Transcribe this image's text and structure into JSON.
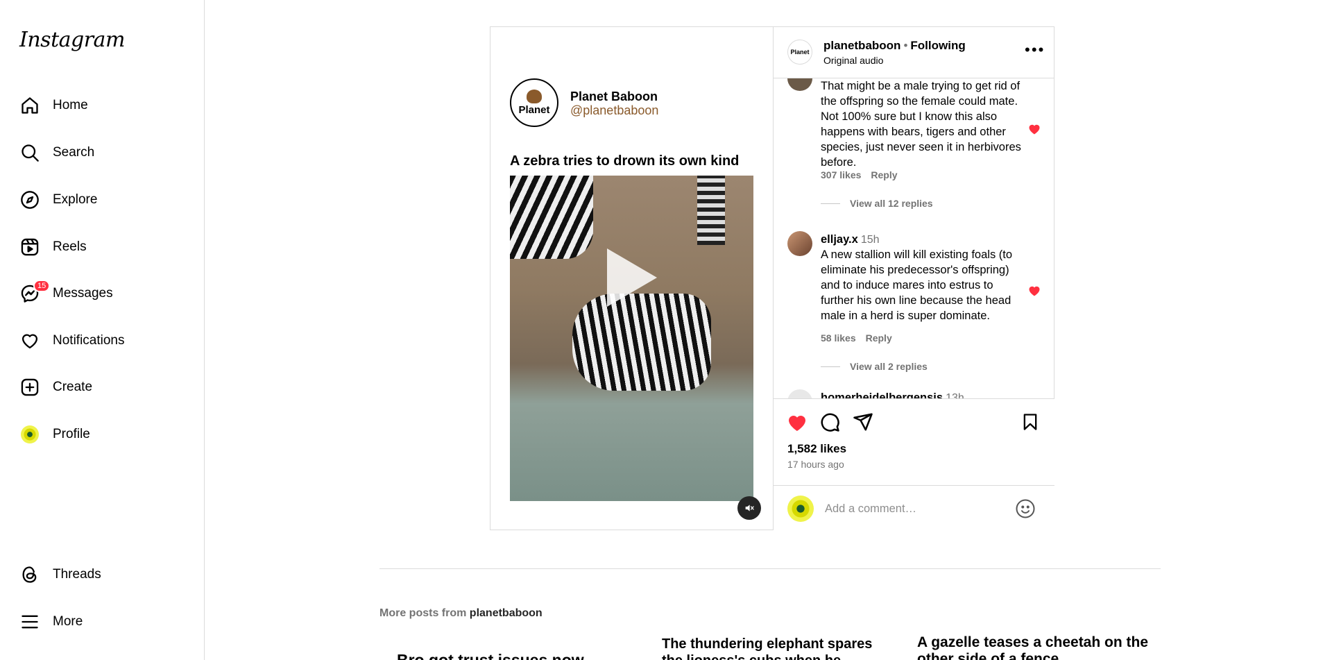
{
  "app": {
    "logo_text": "Instagram"
  },
  "sidebar": {
    "items": [
      {
        "label": "Home",
        "icon": "home-icon"
      },
      {
        "label": "Search",
        "icon": "search-icon"
      },
      {
        "label": "Explore",
        "icon": "explore-icon"
      },
      {
        "label": "Reels",
        "icon": "reels-icon"
      },
      {
        "label": "Messages",
        "icon": "messenger-icon",
        "badge": "15"
      },
      {
        "label": "Notifications",
        "icon": "heart-icon"
      },
      {
        "label": "Create",
        "icon": "plus-square-icon"
      },
      {
        "label": "Profile",
        "icon": "profile-avatar"
      },
      {
        "label": "Threads",
        "icon": "threads-icon"
      },
      {
        "label": "More",
        "icon": "menu-icon"
      }
    ]
  },
  "post": {
    "media": {
      "brand_logo_text": "Planet",
      "brand_name": "Planet Baboon",
      "brand_handle": "@planetbaboon",
      "video_title": "A zebra tries to drown its own kind"
    },
    "header": {
      "avatar_text": "Planet",
      "username": "planetbaboon",
      "separator": "•",
      "follow_status": "Following",
      "audio": "Original audio"
    },
    "comments": [
      {
        "text": "That might be a male trying to get rid of the offspring so the female could mate. Not 100% sure but I know this also happens with bears, tigers and other species, just never seen it in herbivores before.",
        "likes": "307 likes",
        "reply": "Reply",
        "view_replies": "View all 12 replies"
      },
      {
        "user": "elljay.x",
        "time": "15h",
        "text": "A new stallion will kill existing foals (to eliminate his predecessor's offspring) and to induce mares into estrus to further his own line because the head male in a herd is super dominate.",
        "likes": "58 likes",
        "reply": "Reply",
        "view_replies": "View all 2 replies"
      },
      {
        "user": "homerheidelbergensis",
        "time": "13h"
      }
    ],
    "likes": "1,582 likes",
    "time_ago": "17 hours ago",
    "comment_placeholder": "Add a comment…"
  },
  "more_posts": {
    "prefix": "More posts from",
    "username": "planetbaboon",
    "tiles": [
      {
        "title": "Bro got trust issues now"
      },
      {
        "title": "The thundering elephant spares the lioness's cubs when he realizes"
      },
      {
        "title": "A gazelle teases a cheetah on the other side of a fence"
      }
    ]
  },
  "colors": {
    "like_red": "#ff3040",
    "brand_brown": "#8a5a2b",
    "muted_gray": "#737373",
    "border": "#dbdbdb"
  }
}
